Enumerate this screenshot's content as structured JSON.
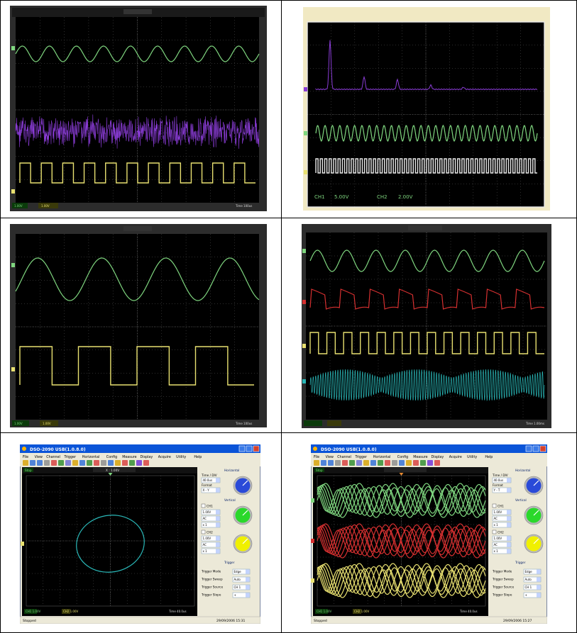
{
  "panels": [
    {
      "id": "scope-1",
      "ch1": "CH1",
      "ch2": "CH2",
      "ch1_volts": "1.00V",
      "ch2_volts": "1.00V",
      "time": "Time 100us"
    },
    {
      "id": "scope-2",
      "ch1_label": "CH1",
      "ch1_volts": "5.00V",
      "ch2_label": "CH2",
      "ch2_volts": "2.00V"
    },
    {
      "id": "scope-3",
      "ch1_volts": "1.00V",
      "ch2_volts": "1.00V",
      "time": "Time 100us"
    },
    {
      "id": "scope-4",
      "time": "Time 1.00ms"
    },
    {
      "id": "app-xy",
      "title": "DSO-2090 USB(1.0.8.0)",
      "menu": [
        "File",
        "View",
        "Channel",
        "Trigger",
        "Horizontal",
        "Config",
        "Measure",
        "Display",
        "Acquire",
        "Utility",
        "Help"
      ],
      "tab": "Stop",
      "trig_readout": "X : 1.00V",
      "side": {
        "timebase_label": "Horizontal",
        "time_div_label": "Time / DIV",
        "time_div": "40.0us",
        "format_label": "Format",
        "format": "X - Y",
        "vertical_label": "Vertical",
        "ch1_label": "CH1",
        "ch1_volt": "1.00V",
        "ch1_coupling": "AC",
        "ch1_probe": "x 1",
        "ch2_label": "CH2",
        "ch2_volt": "1.00V",
        "ch2_coupling": "AC",
        "ch2_probe": "x 1",
        "trigger_label": "Trigger",
        "trig_mode_label": "Trigger Mode",
        "trig_mode": "Edge",
        "trig_sweep_label": "Trigger Sweep",
        "trig_sweep": "Auto",
        "trig_source_label": "Trigger Source",
        "trig_source": "CH 1",
        "trig_slope_label": "Trigger Slope",
        "trig_slope": "+"
      },
      "foot_ch1": "CH1 1.00V",
      "foot_ch2": "CH2 1.00V",
      "foot_time": "Time 40.0us",
      "status_left": "Stopped",
      "status_right": "29/09/2006   15:31"
    },
    {
      "id": "app-persist",
      "title": "DSO-2090 USB(1.0.8.0)",
      "menu": [
        "File",
        "View",
        "Channel",
        "Trigger",
        "Horizontal",
        "Config",
        "Measure",
        "Display",
        "Acquire",
        "Utility",
        "Help"
      ],
      "tab": "Stop",
      "side": {
        "timebase_label": "Horizontal",
        "time_div_label": "Time / DIV",
        "time_div": "40.0us",
        "format_label": "Format",
        "format": "Y - T",
        "vertical_label": "Vertical",
        "ch1_label": "CH1",
        "ch1_volt": "1.00V",
        "ch1_coupling": "AC",
        "ch1_probe": "x 1",
        "ch2_label": "CH2",
        "ch2_volt": "1.00V",
        "ch2_coupling": "AC",
        "ch2_probe": "x 1",
        "trigger_label": "Trigger",
        "trig_mode_label": "Trigger Mode",
        "trig_mode": "Edge",
        "trig_sweep_label": "Trigger Sweep",
        "trig_sweep": "Auto",
        "trig_source_label": "Trigger Source",
        "trig_source": "CH 1",
        "trig_slope_label": "Trigger Slope",
        "trig_slope": "+"
      },
      "foot_ch1": "CH1 1.00V",
      "foot_ch2": "CH2 1.00V",
      "foot_time": "Time 40.0us",
      "status_left": "Stopped",
      "status_right": "29/09/2006   15:27"
    }
  ],
  "colors": {
    "ch1": "#7fd67f",
    "ch2": "#e8e070",
    "math": "#8a3cd6",
    "ref": "#d63030",
    "ch4": "#2ab8b8",
    "grid": "#5a5a5a",
    "bg": "#000000"
  }
}
